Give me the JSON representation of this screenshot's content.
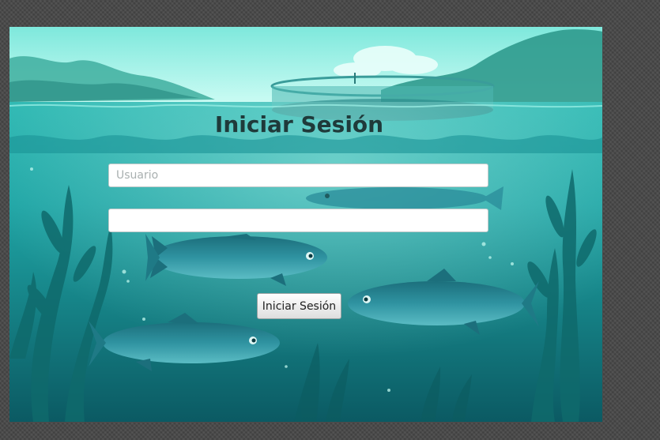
{
  "login": {
    "title": "Iniciar Sesión",
    "username_placeholder": "Usuario",
    "username_value": "",
    "password_value": "",
    "submit_label": "Iniciar Sesión"
  },
  "colors": {
    "sky": "#8ff0e4",
    "water": "#2aa8a8",
    "deep_water": "#0e5f66",
    "fish": "#2a8c9a",
    "title_text": "#1f3a3a"
  }
}
